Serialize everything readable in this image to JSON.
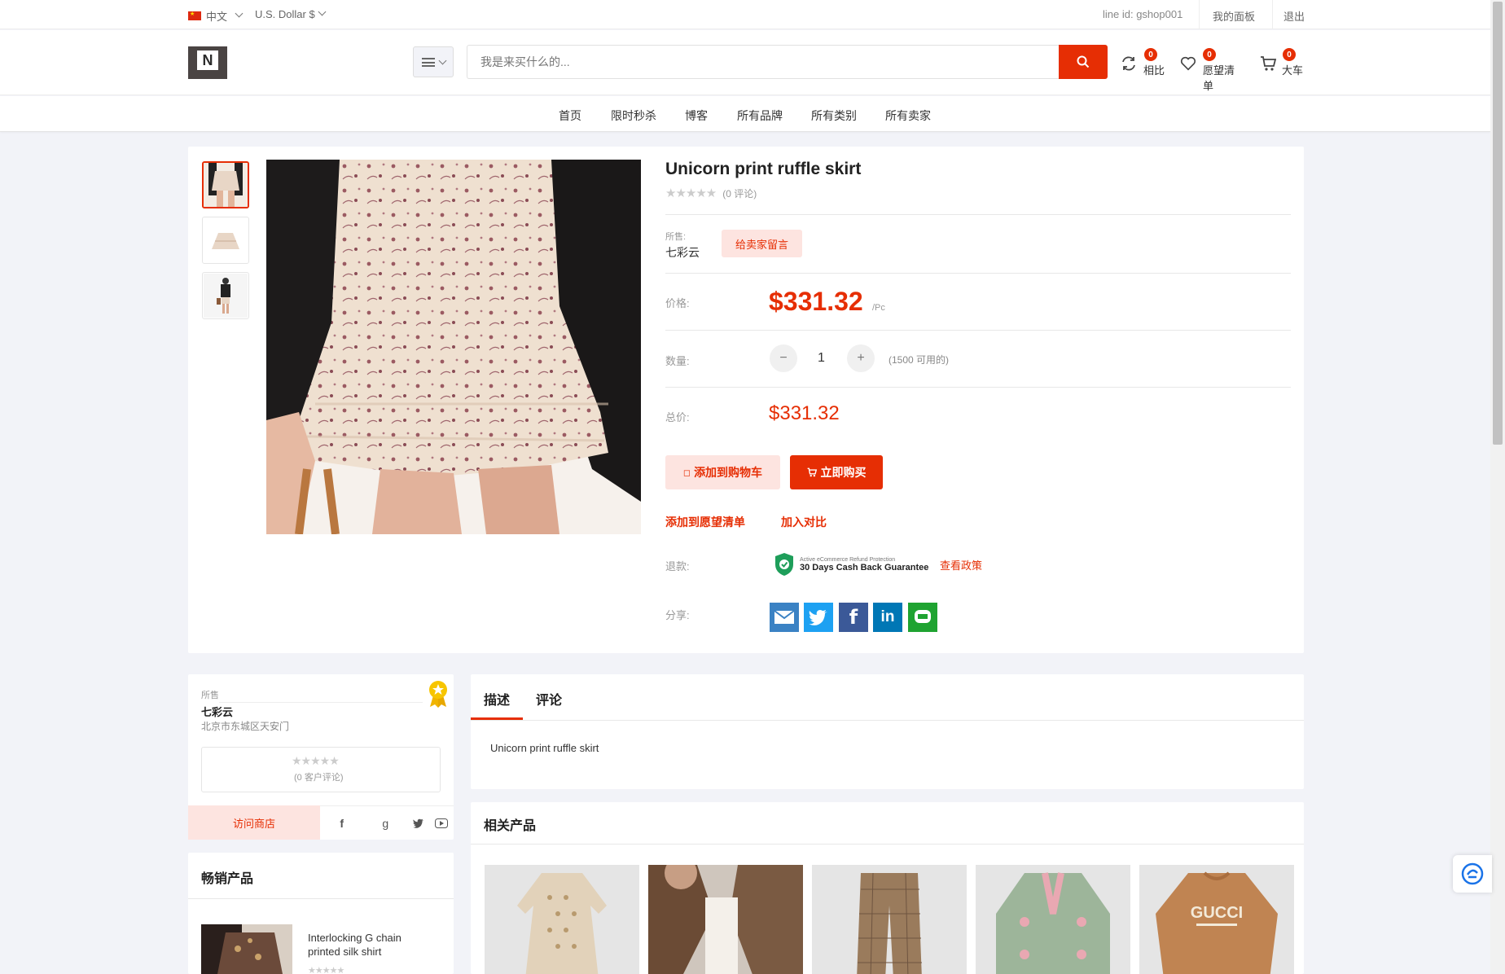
{
  "topbar": {
    "language": "中文",
    "currency": "U.S. Dollar $",
    "line_id": "line id: gshop001",
    "dashboard": "我的面板",
    "logout": "退出"
  },
  "header": {
    "logo_letter": "N",
    "search_placeholder": "我是来买什么的...",
    "compare": {
      "count": "0",
      "label": "相比"
    },
    "wishlist": {
      "count": "0",
      "label": "愿望清单"
    },
    "cart": {
      "count": "0",
      "label": "大车"
    }
  },
  "nav": [
    "首页",
    "限时秒杀",
    "博客",
    "所有品牌",
    "所有类别",
    "所有卖家"
  ],
  "product": {
    "title": "Unicorn print ruffle skirt",
    "rating_stars": 0,
    "review_count": "(0 评论)",
    "sold_by_label": "所售:",
    "seller": "七彩云",
    "message_seller": "给卖家留言",
    "price_label": "价格:",
    "price": "$331.32",
    "unit": "/Pc",
    "qty_label": "数量:",
    "qty": "1",
    "available": "(1500 可用的)",
    "total_label": "总价:",
    "total": "$331.32",
    "add_to_cart": "添加到购物车",
    "buy_now": "立即购买",
    "add_wishlist": "添加到愿望清单",
    "add_compare": "加入对比",
    "refund_label": "退款:",
    "refund_badge_small": "Active eCommerce Refund Protection",
    "refund_badge_big": "30 Days Cash Back Guarantee",
    "view_policy": "查看政策",
    "share_label": "分享:"
  },
  "seller_box": {
    "sold_by": "所售",
    "name": "七彩云",
    "address": "北京市东城区天安门",
    "reviews": "(0 客户评论)",
    "visit_store": "访问商店"
  },
  "tabs": [
    "描述",
    "评论"
  ],
  "description": "Unicorn print ruffle skirt",
  "related_title": "相关产品",
  "bestsellers": {
    "title": "畅销产品",
    "items": [
      {
        "name": "Interlocking G chain printed silk shirt"
      }
    ]
  },
  "colors": {
    "accent": "#e62e04",
    "soft": "#fde4e0"
  }
}
